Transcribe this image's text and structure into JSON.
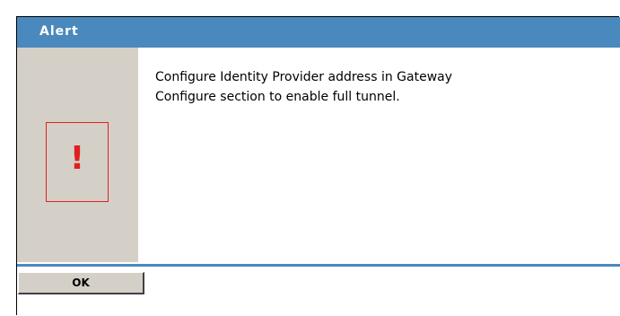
{
  "dialog": {
    "title": "Alert",
    "message_lines": [
      "Configure Identity Provider address in Gateway",
      "Configure section to enable full tunnel."
    ],
    "icon": {
      "name": "exclamation-icon",
      "glyph": "!",
      "color": "#e02020"
    },
    "ok_label": "OK"
  },
  "colors": {
    "titlebar": "#4a89bd",
    "panel": "#d4d0c8",
    "title_text": "#ffffff"
  }
}
